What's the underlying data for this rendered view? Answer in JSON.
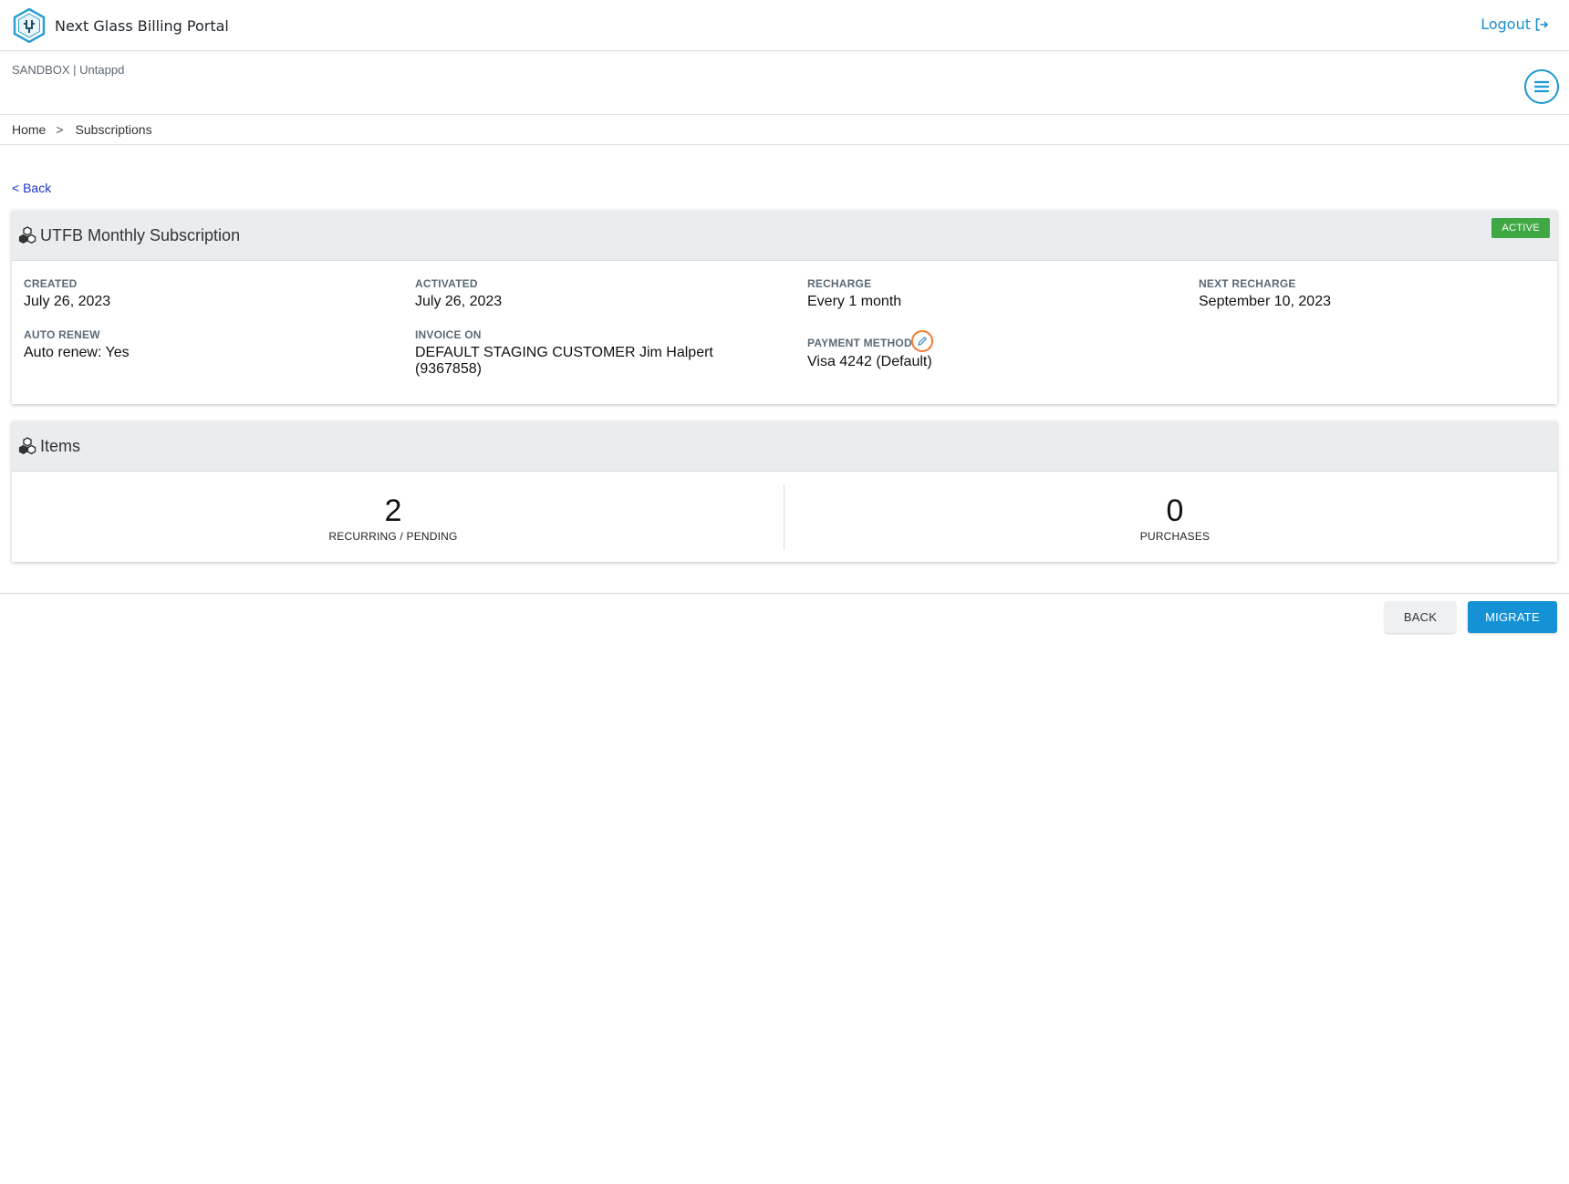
{
  "header": {
    "app_name": "Next Glass Billing Portal",
    "logout_label": "Logout"
  },
  "org": {
    "label": "SANDBOX | Untappd"
  },
  "breadcrumb": {
    "home": "Home",
    "separator": ">",
    "current": "Subscriptions"
  },
  "back_link": "< Back",
  "subscription": {
    "title": "UTFB Monthly Subscription",
    "status": "ACTIVE",
    "fields": {
      "created_label": "CREATED",
      "created_value": "July 26, 2023",
      "activated_label": "ACTIVATED",
      "activated_value": "July 26, 2023",
      "recharge_label": "RECHARGE",
      "recharge_value": "Every 1 month",
      "next_recharge_label": "NEXT RECHARGE",
      "next_recharge_value": "September 10, 2023",
      "auto_renew_label": "AUTO RENEW",
      "auto_renew_value": "Auto renew: Yes",
      "invoice_on_label": "INVOICE ON",
      "invoice_on_value": "DEFAULT STAGING CUSTOMER Jim Halpert (9367858)",
      "payment_method_label": "PAYMENT METHOD",
      "payment_method_value": "Visa 4242 (Default)"
    }
  },
  "items": {
    "title": "Items",
    "recurring_count": "2",
    "recurring_label": "RECURRING / PENDING",
    "purchases_count": "0",
    "purchases_label": "PURCHASES"
  },
  "actions": {
    "back_label": "BACK",
    "migrate_label": "MIGRATE"
  },
  "colors": {
    "accent": "#1a9ad6",
    "status_active": "#3fa845",
    "link": "#1a33cc",
    "highlight": "#f07a35"
  },
  "icons": [
    "hexagon-logo-icon",
    "logout-icon",
    "menu-icon",
    "cubes-icon",
    "edit-pencil-icon"
  ]
}
